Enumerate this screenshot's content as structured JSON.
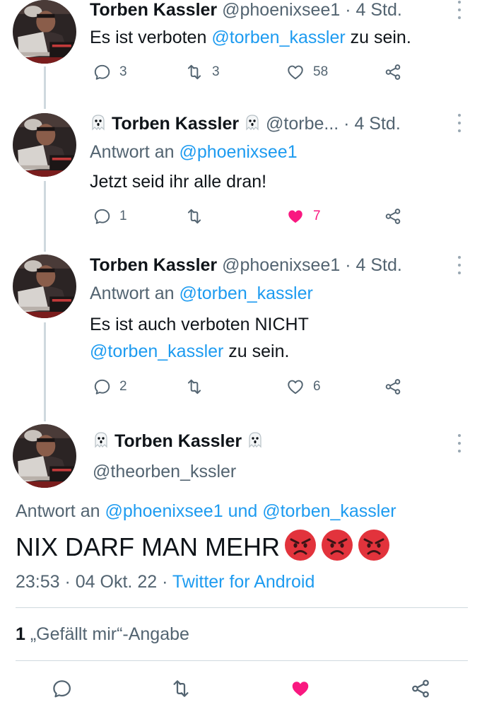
{
  "tweets": [
    {
      "display_name": "Torben Kassler",
      "handle": "@phoenixsee1",
      "dot": "·",
      "time": "4 Std.",
      "text_pre": "Es ist verboten ",
      "text_link": "@torben_kassler",
      "text_post": " zu sein.",
      "replies": "3",
      "retweets": "3",
      "likes": "58"
    },
    {
      "display_name": "Torben Kassler",
      "handle": "@torbe...",
      "dot": "·",
      "time": "4 Std.",
      "reply_to_label": "Antwort an ",
      "reply_to_handle": "@phoenixsee1",
      "text": "Jetzt seid ihr alle dran!",
      "replies": "1",
      "retweets": "",
      "likes": "7"
    },
    {
      "display_name": "Torben Kassler",
      "handle": "@phoenixsee1",
      "dot": "·",
      "time": "4 Std.",
      "reply_to_label": "Antwort an ",
      "reply_to_handle": "@torben_kassler",
      "text_line1": "Es ist auch verboten NICHT",
      "text_link": "@torben_kassler",
      "text_post": " zu sein.",
      "replies": "2",
      "retweets": "",
      "likes": "6"
    }
  ],
  "focused": {
    "display_name": "Torben Kassler",
    "handle": "@theorben_kssler",
    "reply_to_label": "Antwort an ",
    "reply_to_handle1": "@phoenixsee1",
    "reply_to_and": " und ",
    "reply_to_handle2": "@torben_kassler",
    "text": "NIX DARF MAN MEHR",
    "emoji": [
      "angry-face",
      "angry-face",
      "angry-face"
    ],
    "timestamp": "23:53 · 04 Okt. 22 · ",
    "source": "Twitter for Android",
    "likes_count": "1",
    "likes_label": " „Gefällt mir“-Angabe"
  },
  "colors": {
    "link": "#1d9bf0",
    "like": "#f91880",
    "text_secondary": "#536471",
    "thread_line": "#cfd9de"
  }
}
